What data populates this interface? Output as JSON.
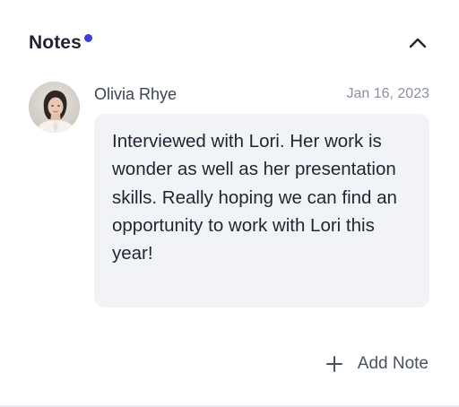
{
  "header": {
    "title": "Notes",
    "unread_dot_color": "#3b3fd6",
    "collapse_icon": "chevron-up-icon"
  },
  "note": {
    "author": "Olivia Rhye",
    "date": "Jan 16, 2023",
    "text": "Interviewed with Lori. Her work is wonder as well as her presentation skills. Really hoping we can find an opportunity to work with Lori this year!"
  },
  "actions": {
    "add_note_label": "Add Note",
    "add_note_icon": "plus-icon"
  }
}
